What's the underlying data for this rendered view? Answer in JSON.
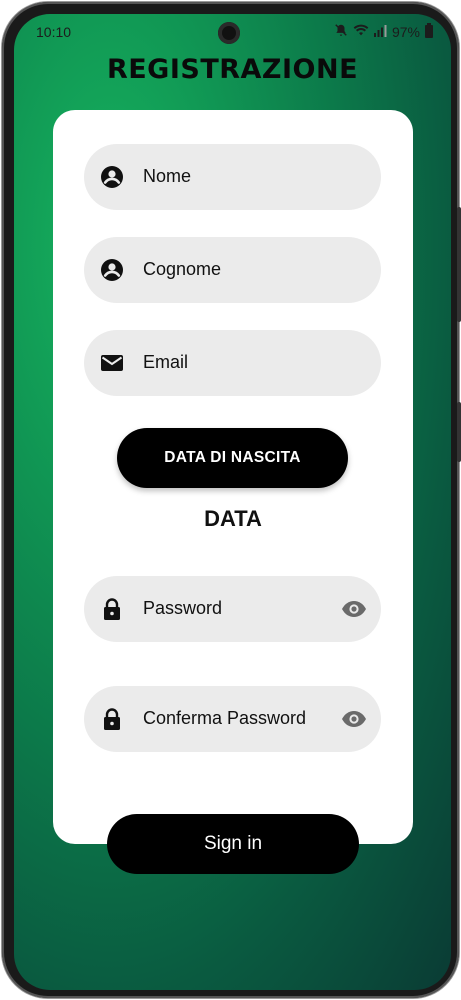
{
  "status_bar": {
    "time": "10:10",
    "battery": "97%",
    "icons": [
      "mute-icon",
      "wifi-icon",
      "signal-icon",
      "battery-icon"
    ]
  },
  "page": {
    "title": "REGISTRAZIONE"
  },
  "form": {
    "nome": {
      "label": "Nome",
      "icon": "account-circle-icon"
    },
    "cognome": {
      "label": "Cognome",
      "icon": "account-circle-icon"
    },
    "email": {
      "label": "Email",
      "icon": "mail-icon"
    },
    "date_button": "DATA DI NASCITA",
    "date_value": "DATA",
    "password": {
      "label": "Password",
      "icon": "lock-icon",
      "toggle_icon": "eye-icon"
    },
    "confirm_password": {
      "label": "Conferma Password",
      "icon": "lock-icon",
      "toggle_icon": "eye-icon"
    }
  },
  "actions": {
    "sign_in": "Sign in"
  },
  "colors": {
    "background_green": "#119a55",
    "background_dark": "#0a3b34",
    "card": "#ffffff",
    "field": "#ebebeb",
    "button": "#000000"
  }
}
